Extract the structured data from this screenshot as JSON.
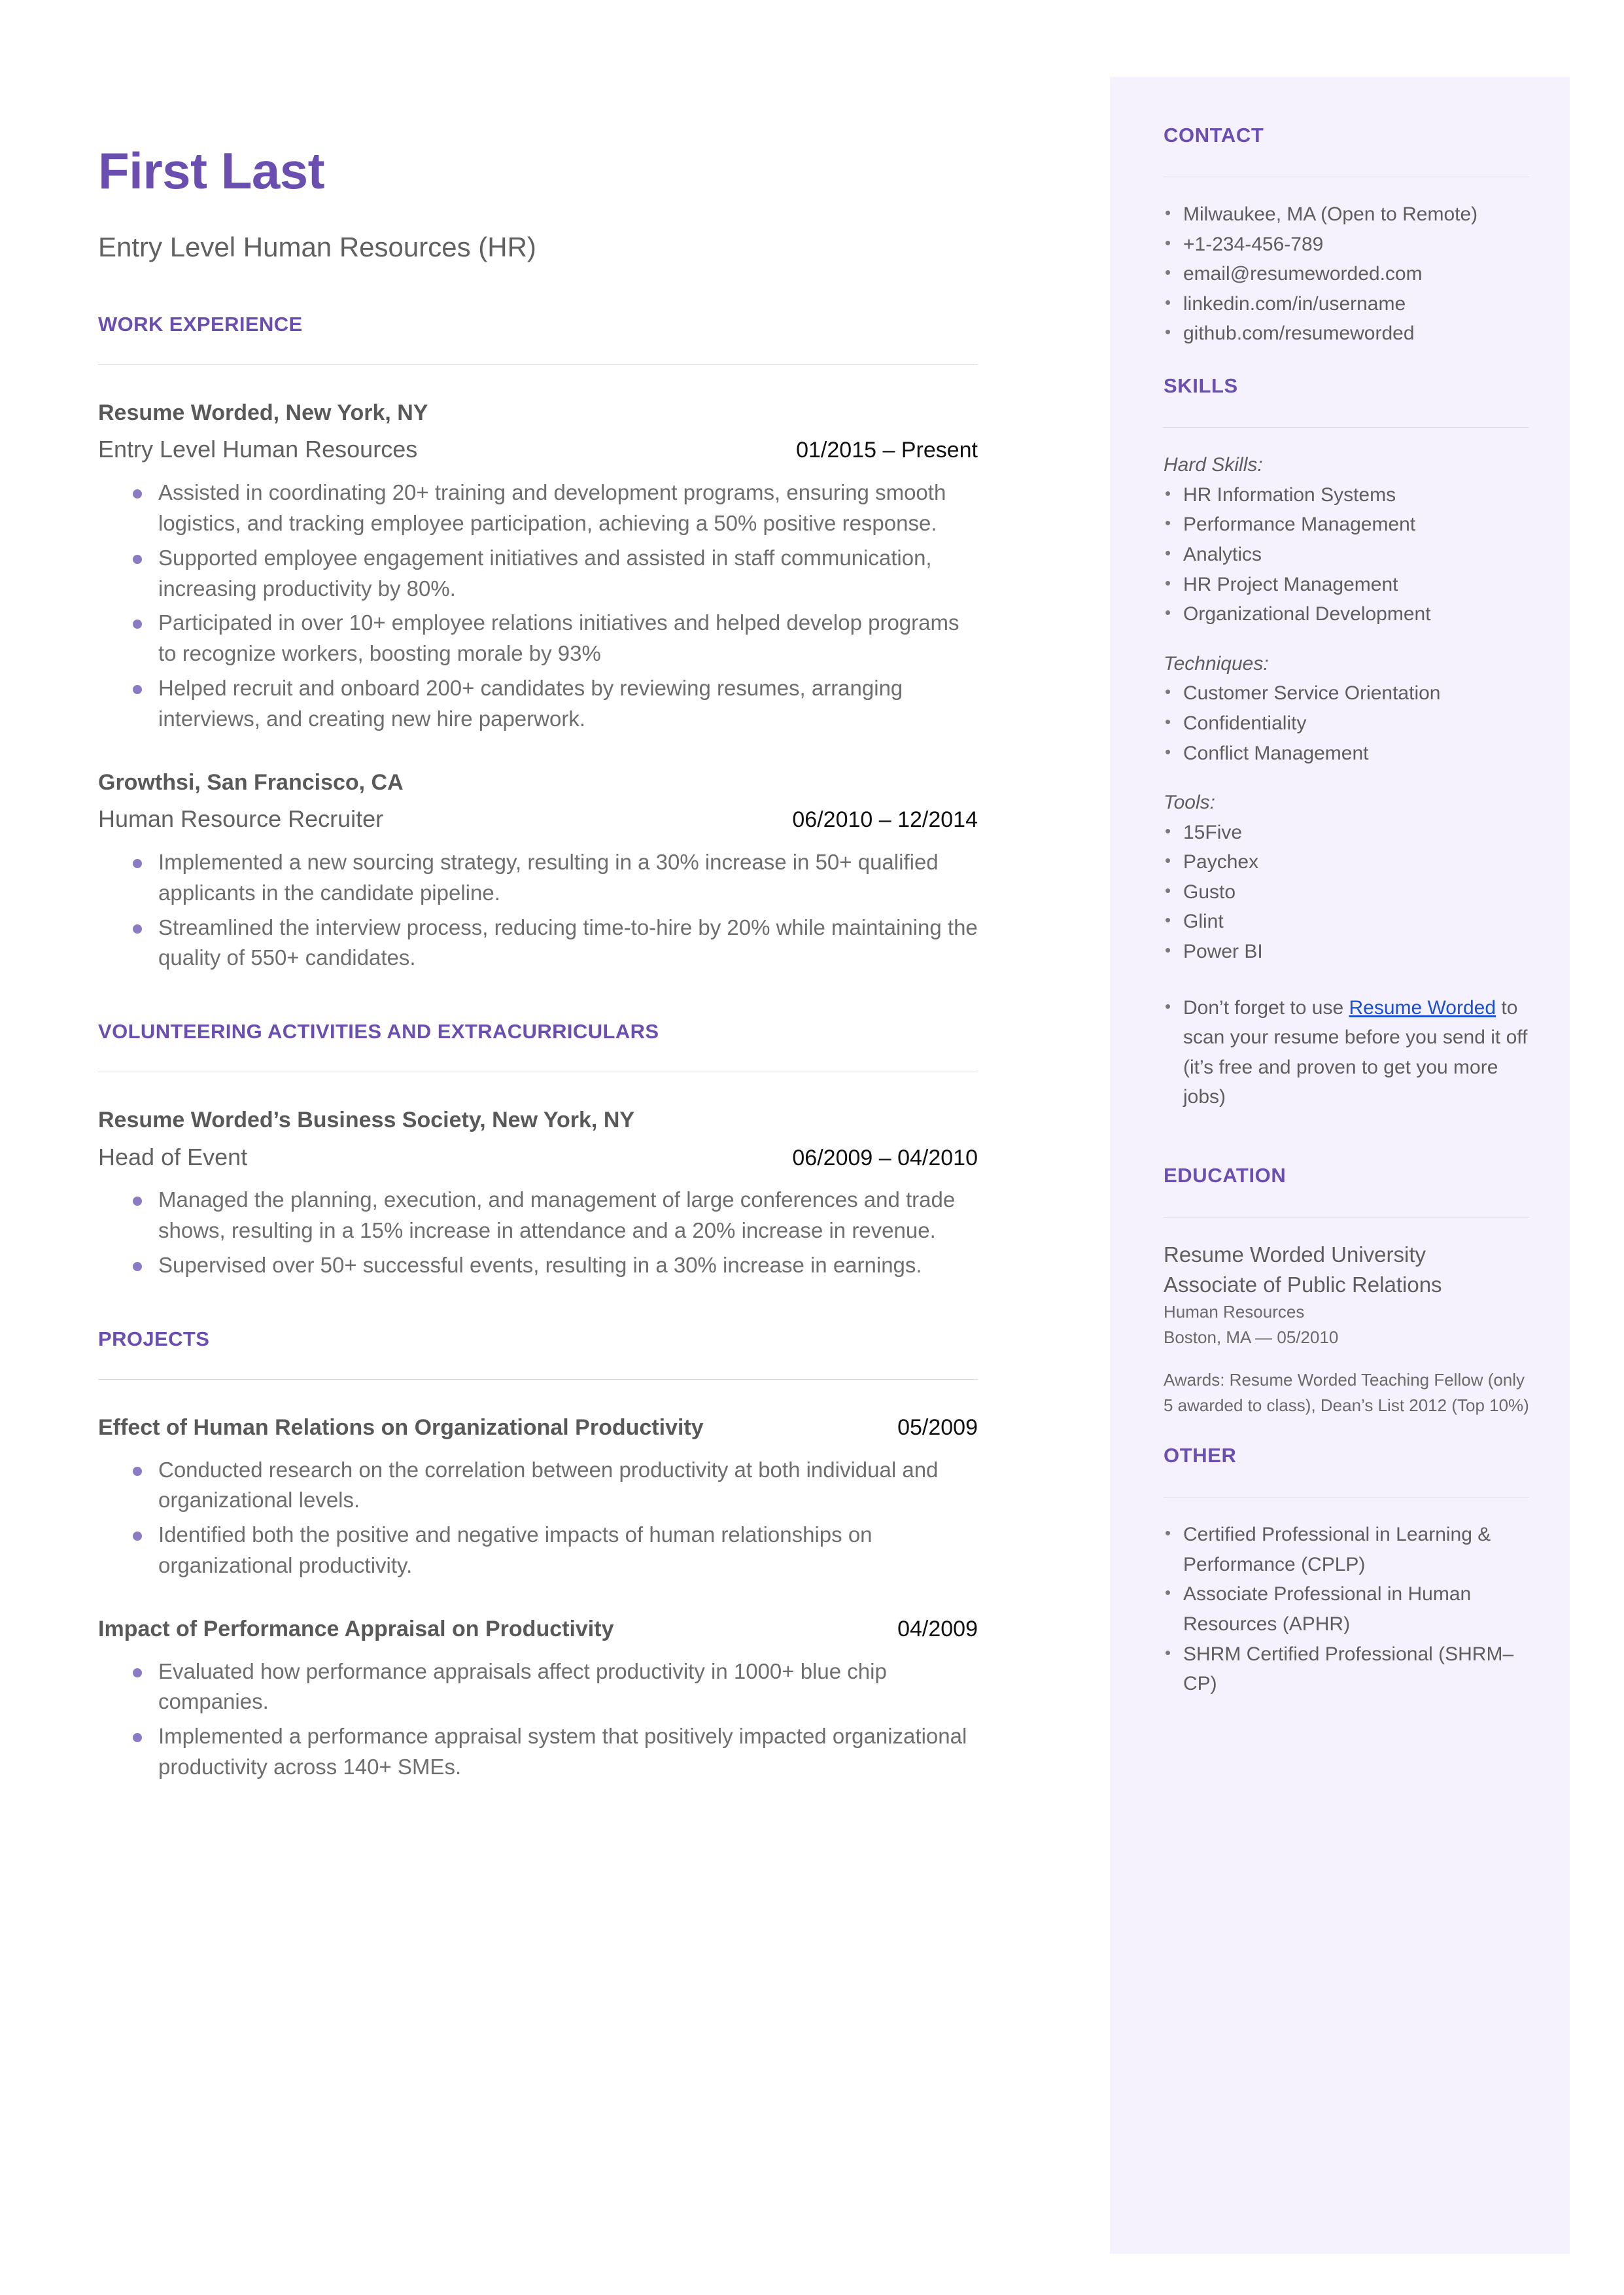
{
  "header": {
    "name": "First Last",
    "title": "Entry Level Human Resources (HR)"
  },
  "colors": {
    "accent_purple": "#6B4FB0",
    "sidebar_bg": "#F5F2FD",
    "bullet_purple": "#8B7BC4",
    "body_text": "#6E6E6E",
    "link_blue": "#1A4FD6"
  },
  "sections": {
    "work_experience": {
      "heading": "WORK EXPERIENCE",
      "entries": [
        {
          "organization": "Resume Worded, New York, NY",
          "role": "Entry Level Human Resources",
          "dates": "01/2015 – Present",
          "bullets": [
            "Assisted in coordinating 20+ training and development programs, ensuring smooth logistics, and tracking employee participation, achieving a 50% positive response.",
            "Supported employee engagement initiatives and assisted in staff communication, increasing productivity by 80%.",
            "Participated in over 10+ employee relations initiatives and helped develop programs to recognize workers, boosting morale by 93%",
            "Helped recruit and onboard 200+ candidates by reviewing resumes, arranging interviews, and creating new hire paperwork."
          ]
        },
        {
          "organization": "Growthsi, San Francisco, CA",
          "role": "Human Resource Recruiter",
          "dates": "06/2010 – 12/2014",
          "bullets": [
            "Implemented a new sourcing strategy, resulting in a 30% increase in 50+ qualified applicants in the candidate pipeline.",
            "Streamlined the interview process, reducing time-to-hire by 20% while maintaining the quality of 550+ candidates."
          ]
        }
      ]
    },
    "volunteering": {
      "heading": "VOLUNTEERING ACTIVITIES AND EXTRACURRICULARS",
      "entries": [
        {
          "organization": "Resume Worded’s Business Society, New York, NY",
          "role": "Head of Event",
          "dates": "06/2009 – 04/2010",
          "bullets": [
            "Managed the planning, execution, and management of large conferences and trade shows, resulting in a 15% increase in attendance and a 20% increase in revenue.",
            "Supervised over 50+ successful events, resulting in a 30% increase in earnings."
          ]
        }
      ]
    },
    "projects": {
      "heading": "PROJECTS",
      "entries": [
        {
          "title": "Effect of Human Relations on Organizational Productivity",
          "date": "05/2009",
          "bullets": [
            "Conducted research on the correlation between productivity at both individual and organizational levels.",
            "Identified both the positive and negative impacts of human relationships on organizational productivity."
          ]
        },
        {
          "title": "Impact of Performance Appraisal on Productivity",
          "date": "04/2009",
          "bullets": [
            "Evaluated how performance appraisals affect productivity in 1000+ blue chip companies.",
            "Implemented a performance appraisal system that positively impacted organizational productivity across 140+ SMEs."
          ]
        }
      ]
    }
  },
  "sidebar": {
    "contact": {
      "heading": "CONTACT",
      "items": [
        "Milwaukee, MA (Open to Remote)",
        "+1-234-456-789",
        "email@resumeworded.com",
        "linkedin.com/in/username",
        "github.com/resumeworded"
      ]
    },
    "skills": {
      "heading": "SKILLS",
      "groups": [
        {
          "label": "Hard Skills:",
          "items": [
            "HR Information Systems",
            "Performance Management",
            "Analytics",
            "HR Project Management",
            "Organizational Development"
          ]
        },
        {
          "label": "Techniques:",
          "items": [
            "Customer Service Orientation",
            "Confidentiality",
            "Conflict Management"
          ]
        },
        {
          "label": "Tools:",
          "items": [
            "15Five",
            "Paychex",
            "Gusto",
            "Glint",
            "Power BI"
          ]
        }
      ],
      "note_prefix": "Don’t forget to use ",
      "note_link": "Resume Worded",
      "note_suffix": " to scan your resume before you send it off (it’s free and proven to get you more jobs)"
    },
    "education": {
      "heading": "EDUCATION",
      "school": "Resume Worded University",
      "degree": "Associate of Public Relations",
      "field": "Human Resources",
      "location_date": "Boston, MA — 05/2010",
      "awards": "Awards: Resume Worded Teaching Fellow (only 5 awarded to class), Dean’s List 2012 (Top 10%)"
    },
    "other": {
      "heading": "OTHER",
      "items": [
        "Certified Professional in Learning & Performance (CPLP)",
        "Associate Professional in Human Resources (APHR)",
        "SHRM Certified Professional (SHRM–CP)"
      ]
    }
  }
}
